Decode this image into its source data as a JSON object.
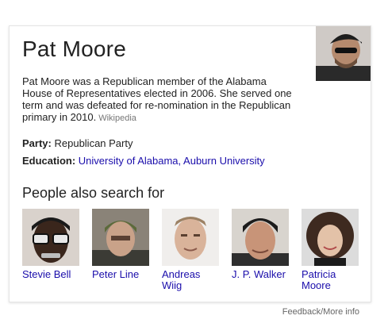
{
  "entity": {
    "name": "Pat Moore",
    "description": "Pat Moore was a Republican member of the Alabama House of Representatives elected in 2006. She served one term and was defeated for re-nomination in the Republican primary in 2010.",
    "source": "Wikipedia"
  },
  "facts": {
    "party_label": "Party:",
    "party_value": "Republican Party",
    "education_label": "Education:",
    "education_school_1": "University of Alabama",
    "education_separator": ", ",
    "education_school_2": "Auburn University"
  },
  "people_also_search": {
    "heading": "People also search for",
    "items": [
      {
        "name": "Stevie Bell"
      },
      {
        "name": "Peter Line"
      },
      {
        "name": "Andreas Wiig"
      },
      {
        "name": "J. P. Walker"
      },
      {
        "name": "Patricia Moore"
      }
    ]
  },
  "footer": {
    "feedback": "Feedback/More info"
  },
  "colors": {
    "link": "#1a0dab",
    "text": "#222222",
    "muted": "#777777"
  }
}
